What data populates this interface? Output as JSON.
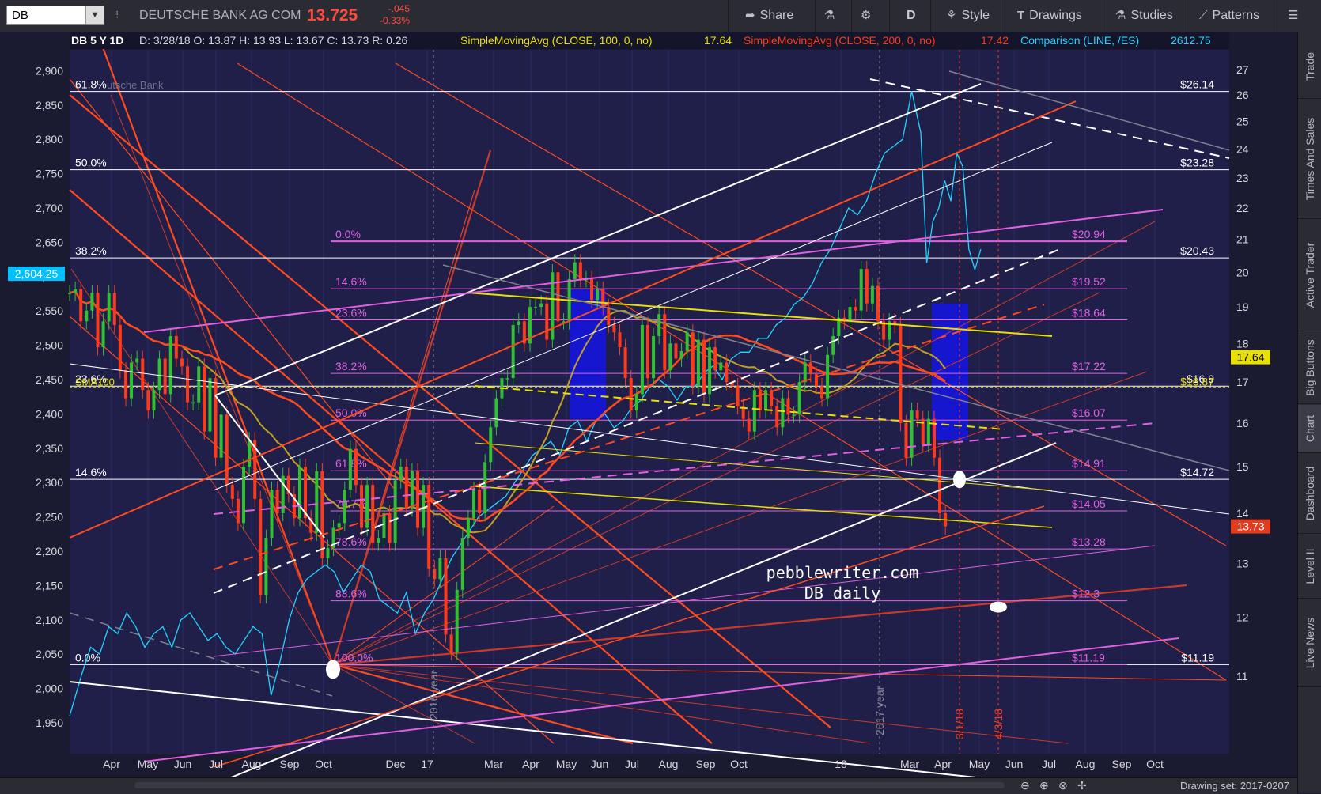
{
  "toolbar": {
    "symbol": "DB",
    "company": "DEUTSCHE BANK AG COM",
    "last": "13.725",
    "change": "-.045",
    "change_pct": "-0.33%",
    "share": "Share",
    "period": "D",
    "style": "Style",
    "drawings": "Drawings",
    "studies": "Studies",
    "patterns": "Patterns"
  },
  "sidebar": [
    "Trade",
    "Times And Sales",
    "Active Trader",
    "Big Buttons",
    "Chart",
    "Dashboard",
    "Level II",
    "Live News"
  ],
  "sidebar_active": 4,
  "status": {
    "drawing_set": "Drawing set: 2017-0207"
  },
  "header": {
    "title": "DB 5 Y 1D",
    "ohlc": "D: 3/28/18  O: 13.87  H: 13.93  L: 13.67  C: 13.73  R: 0.26",
    "sma100": "SimpleMovingAvg (CLOSE, 100, 0, no)",
    "sma100_val": "17.64",
    "sma200": "SimpleMovingAvg (CLOSE, 200, 0, no)",
    "sma200_val": "17.42",
    "comparison": "Comparison (LINE, /ES)",
    "comparison_val": "2612.75"
  },
  "watermark": "utsche Bank",
  "chart_data": {
    "type": "candlestick",
    "left_axis": {
      "ticks": [
        1950,
        2000,
        2050,
        2100,
        2150,
        2200,
        2250,
        2300,
        2350,
        2400,
        2450,
        2500,
        2550,
        2600,
        2650,
        2700,
        2750,
        2800,
        2850,
        2900
      ],
      "marker": "2,604.25",
      "marker_value": 2604.25,
      "marker_color": "#00c0ff"
    },
    "right_axis": {
      "ticks": [
        11,
        12,
        13,
        14,
        15,
        16,
        17,
        18,
        19,
        20,
        21,
        22,
        23,
        24,
        25,
        26,
        27
      ],
      "badges": [
        {
          "label": "17.64",
          "value": 17.64,
          "color": "#e8e000"
        },
        {
          "label": "13.73",
          "value": 13.73,
          "color": "#e23b1e"
        }
      ]
    },
    "x_ticks": [
      "Apr",
      "May",
      "Jun",
      "Jul",
      "Aug",
      "Sep",
      "Oct",
      "Dec",
      "17",
      "Mar",
      "Apr",
      "May",
      "Jun",
      "Jul",
      "Aug",
      "Sep",
      "Oct",
      "18",
      "Mar",
      "Apr",
      "May",
      "Jun",
      "Jul",
      "Aug",
      "Sep",
      "Oct"
    ],
    "fib_long": [
      {
        "label": "61.8%",
        "price_label": "$26.14",
        "value": 26.14
      },
      {
        "label": "50.0%",
        "price_label": "$23.28",
        "value": 23.28
      },
      {
        "label": "38.2%",
        "price_label": "$20.43",
        "value": 20.43
      },
      {
        "label": "23.6%",
        "price_label": "$16.9",
        "value": 16.9
      },
      {
        "label": "14.6%",
        "price_label": "$14.72",
        "value": 14.72
      },
      {
        "label": "0.0%",
        "price_label": "$11.19",
        "value": 11.19
      }
    ],
    "fib_short": [
      {
        "label": "0.0%",
        "price_label": "$20.94",
        "value": 20.94
      },
      {
        "label": "14.6%",
        "price_label": "$19.52",
        "value": 19.52
      },
      {
        "label": "23.6%",
        "price_label": "$18.64",
        "value": 18.64
      },
      {
        "label": "38.2%",
        "price_label": "$17.22",
        "value": 17.22
      },
      {
        "label": "50.0%",
        "price_label": "$16.07",
        "value": 16.07
      },
      {
        "label": "61.8%",
        "price_label": "$14.91",
        "value": 14.91
      },
      {
        "label": "70.7%",
        "price_label": "$14.05",
        "value": 14.05
      },
      {
        "label": "78.6%",
        "price_label": "$13.28",
        "value": 13.28
      },
      {
        "label": "88.6%",
        "price_label": "$12.3",
        "value": 12.3
      },
      {
        "label": "100.0%",
        "price_label": "$11.19",
        "value": 11.19
      }
    ],
    "sma_label": "SMA100",
    "sma_price_label": "$16.87",
    "annotations": [
      "pebblewriter.com",
      "DB daily"
    ],
    "vlines": [
      "2016 year",
      "2017 year",
      "3/1/18",
      "4/3/18"
    ],
    "db_series": [
      [
        0,
        19.4
      ],
      [
        5,
        19.5
      ],
      [
        10,
        18.6
      ],
      [
        15,
        18.9
      ],
      [
        20,
        19.4
      ],
      [
        25,
        17.9
      ],
      [
        30,
        18.6
      ],
      [
        35,
        19.4
      ],
      [
        40,
        18.5
      ],
      [
        45,
        17.3
      ],
      [
        50,
        16.6
      ],
      [
        55,
        17.5
      ],
      [
        60,
        17.6
      ],
      [
        65,
        16.8
      ],
      [
        70,
        16.3
      ],
      [
        75,
        16.8
      ],
      [
        80,
        17.6
      ],
      [
        85,
        16.7
      ],
      [
        90,
        18.2
      ],
      [
        95,
        17.6
      ],
      [
        100,
        17.4
      ],
      [
        105,
        16.5
      ],
      [
        110,
        16.5
      ],
      [
        115,
        17.4
      ],
      [
        120,
        15.8
      ],
      [
        125,
        17.1
      ],
      [
        130,
        15.2
      ],
      [
        135,
        16.2
      ],
      [
        140,
        14.6
      ],
      [
        145,
        14.3
      ],
      [
        150,
        13.8
      ],
      [
        155,
        15.0
      ],
      [
        160,
        15.6
      ],
      [
        165,
        14.3
      ],
      [
        170,
        12.4
      ],
      [
        175,
        13.5
      ],
      [
        180,
        14.5
      ],
      [
        185,
        14.0
      ],
      [
        190,
        14.8
      ],
      [
        195,
        14.4
      ],
      [
        200,
        13.9
      ],
      [
        205,
        15.0
      ],
      [
        210,
        13.9
      ],
      [
        215,
        13.6
      ],
      [
        220,
        14.9
      ],
      [
        225,
        13.1
      ],
      [
        230,
        13.3
      ],
      [
        235,
        13.7
      ],
      [
        240,
        13.8
      ],
      [
        245,
        14.5
      ],
      [
        250,
        15.4
      ],
      [
        255,
        14.6
      ],
      [
        260,
        13.7
      ],
      [
        265,
        14.6
      ],
      [
        270,
        13.4
      ],
      [
        275,
        13.5
      ],
      [
        280,
        14.0
      ],
      [
        285,
        13.4
      ],
      [
        290,
        14.7
      ],
      [
        295,
        15.0
      ],
      [
        300,
        14.1
      ],
      [
        305,
        14.9
      ],
      [
        310,
        13.7
      ],
      [
        315,
        14.6
      ],
      [
        320,
        12.9
      ],
      [
        325,
        12.7
      ],
      [
        330,
        13.1
      ],
      [
        335,
        11.7
      ],
      [
        340,
        11.4
      ],
      [
        345,
        12.5
      ],
      [
        350,
        13.5
      ],
      [
        355,
        13.9
      ],
      [
        360,
        14.5
      ],
      [
        365,
        14.0
      ],
      [
        370,
        15.1
      ],
      [
        375,
        15.9
      ],
      [
        380,
        16.6
      ],
      [
        385,
        17.1
      ],
      [
        390,
        17.1
      ],
      [
        395,
        18.5
      ],
      [
        400,
        18.6
      ],
      [
        405,
        18.0
      ],
      [
        410,
        19.0
      ],
      [
        415,
        19.0
      ],
      [
        420,
        19.1
      ],
      [
        425,
        18.1
      ],
      [
        430,
        20.0
      ],
      [
        435,
        18.6
      ],
      [
        440,
        18.6
      ],
      [
        445,
        19.8
      ],
      [
        450,
        20.3
      ],
      [
        455,
        19.8
      ],
      [
        460,
        19.8
      ],
      [
        465,
        19.2
      ],
      [
        470,
        19.5
      ],
      [
        475,
        19.0
      ],
      [
        480,
        18.5
      ],
      [
        485,
        18.3
      ],
      [
        490,
        17.9
      ],
      [
        495,
        17.1
      ],
      [
        500,
        16.3
      ],
      [
        505,
        16.7
      ],
      [
        510,
        18.5
      ],
      [
        515,
        17.1
      ],
      [
        520,
        18.2
      ],
      [
        525,
        18.8
      ],
      [
        530,
        17.3
      ],
      [
        535,
        18.0
      ],
      [
        540,
        17.6
      ],
      [
        545,
        17.8
      ],
      [
        550,
        18.3
      ],
      [
        555,
        16.9
      ],
      [
        560,
        18.1
      ],
      [
        565,
        16.7
      ],
      [
        570,
        17.9
      ],
      [
        575,
        17.3
      ],
      [
        580,
        17.5
      ],
      [
        585,
        17.0
      ],
      [
        590,
        16.9
      ],
      [
        595,
        16.4
      ],
      [
        600,
        16.1
      ],
      [
        605,
        15.8
      ],
      [
        610,
        16.8
      ],
      [
        615,
        16.3
      ],
      [
        620,
        16.8
      ],
      [
        625,
        16.4
      ],
      [
        630,
        15.9
      ],
      [
        635,
        16.6
      ],
      [
        640,
        16.2
      ],
      [
        645,
        16.2
      ],
      [
        650,
        17.0
      ],
      [
        655,
        17.5
      ],
      [
        660,
        17.2
      ],
      [
        665,
        16.9
      ],
      [
        670,
        16.6
      ],
      [
        675,
        17.7
      ],
      [
        680,
        18.2
      ],
      [
        685,
        18.7
      ],
      [
        690,
        18.6
      ],
      [
        695,
        19.0
      ],
      [
        700,
        18.9
      ],
      [
        705,
        20.1
      ],
      [
        710,
        19.1
      ],
      [
        715,
        19.6
      ],
      [
        720,
        18.6
      ],
      [
        725,
        18.1
      ],
      [
        730,
        18.6
      ],
      [
        735,
        18.5
      ],
      [
        740,
        16.0
      ],
      [
        745,
        15.2
      ],
      [
        750,
        16.3
      ],
      [
        755,
        16.1
      ],
      [
        760,
        15.5
      ],
      [
        765,
        16.1
      ],
      [
        770,
        15.2
      ],
      [
        775,
        14.0
      ],
      [
        780,
        13.73
      ]
    ],
    "es_series": [
      [
        0,
        1960
      ],
      [
        8,
        2020
      ],
      [
        14,
        2060
      ],
      [
        20,
        2050
      ],
      [
        26,
        2090
      ],
      [
        32,
        2080
      ],
      [
        38,
        2110
      ],
      [
        44,
        2090
      ],
      [
        50,
        2060
      ],
      [
        56,
        2080
      ],
      [
        62,
        2090
      ],
      [
        68,
        2060
      ],
      [
        74,
        2100
      ],
      [
        80,
        2110
      ],
      [
        86,
        2090
      ],
      [
        92,
        2070
      ],
      [
        98,
        2080
      ],
      [
        104,
        2060
      ],
      [
        110,
        2050
      ],
      [
        116,
        2070
      ],
      [
        122,
        2090
      ],
      [
        128,
        2080
      ],
      [
        134,
        1990
      ],
      [
        140,
        2040
      ],
      [
        146,
        2100
      ],
      [
        152,
        2140
      ],
      [
        158,
        2160
      ],
      [
        164,
        2170
      ],
      [
        170,
        2180
      ],
      [
        176,
        2170
      ],
      [
        182,
        2140
      ],
      [
        188,
        2160
      ],
      [
        194,
        2180
      ],
      [
        200,
        2170
      ],
      [
        206,
        2130
      ],
      [
        212,
        2120
      ],
      [
        218,
        2110
      ],
      [
        224,
        2140
      ],
      [
        230,
        2080
      ],
      [
        236,
        2110
      ],
      [
        242,
        2130
      ],
      [
        248,
        2160
      ],
      [
        254,
        2190
      ],
      [
        260,
        2210
      ],
      [
        266,
        2230
      ],
      [
        272,
        2250
      ],
      [
        278,
        2260
      ],
      [
        284,
        2270
      ],
      [
        290,
        2280
      ],
      [
        296,
        2300
      ],
      [
        302,
        2320
      ],
      [
        308,
        2340
      ],
      [
        314,
        2350
      ],
      [
        320,
        2360
      ],
      [
        326,
        2340
      ],
      [
        332,
        2380
      ],
      [
        338,
        2390
      ],
      [
        344,
        2360
      ],
      [
        350,
        2390
      ],
      [
        356,
        2400
      ],
      [
        362,
        2380
      ],
      [
        368,
        2390
      ],
      [
        374,
        2410
      ],
      [
        380,
        2420
      ],
      [
        386,
        2440
      ],
      [
        392,
        2450
      ],
      [
        398,
        2440
      ],
      [
        404,
        2420
      ],
      [
        410,
        2440
      ],
      [
        416,
        2440
      ],
      [
        422,
        2460
      ],
      [
        428,
        2470
      ],
      [
        434,
        2450
      ],
      [
        440,
        2480
      ],
      [
        446,
        2490
      ],
      [
        452,
        2490
      ],
      [
        458,
        2510
      ],
      [
        464,
        2510
      ],
      [
        470,
        2530
      ],
      [
        476,
        2540
      ],
      [
        482,
        2560
      ],
      [
        488,
        2570
      ],
      [
        494,
        2590
      ],
      [
        500,
        2620
      ],
      [
        506,
        2640
      ],
      [
        512,
        2670
      ],
      [
        518,
        2700
      ],
      [
        524,
        2690
      ],
      [
        530,
        2710
      ],
      [
        536,
        2750
      ],
      [
        542,
        2780
      ],
      [
        548,
        2790
      ],
      [
        554,
        2800
      ],
      [
        560,
        2870
      ],
      [
        566,
        2810
      ],
      [
        570,
        2620
      ],
      [
        574,
        2680
      ],
      [
        578,
        2700
      ],
      [
        582,
        2740
      ],
      [
        586,
        2710
      ],
      [
        590,
        2780
      ],
      [
        594,
        2760
      ],
      [
        598,
        2640
      ],
      [
        602,
        2610
      ],
      [
        606,
        2640
      ]
    ]
  }
}
